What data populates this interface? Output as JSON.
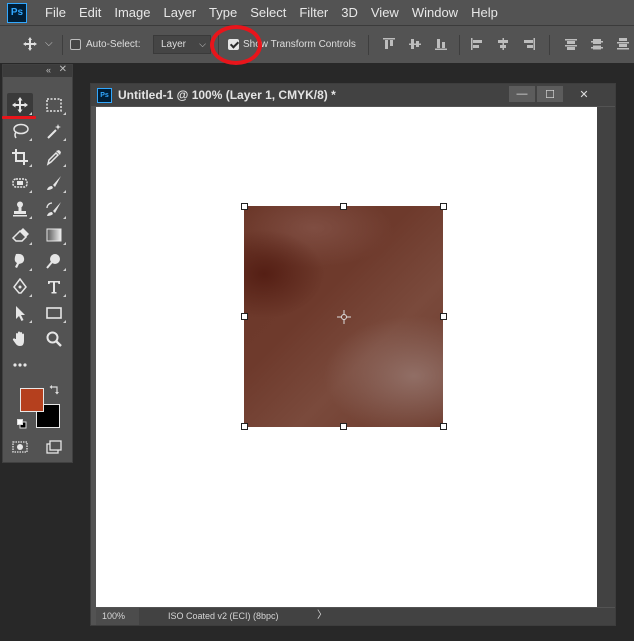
{
  "app": {
    "logo": "Ps",
    "menu": [
      "File",
      "Edit",
      "Image",
      "Layer",
      "Type",
      "Select",
      "Filter",
      "3D",
      "View",
      "Window",
      "Help"
    ]
  },
  "options": {
    "auto_select_label": "Auto-Select:",
    "auto_select_checked": false,
    "target_select_value": "Layer",
    "show_transform_label": "Show Transform Controls",
    "show_transform_checked": true,
    "annotation_color": "#e8151b"
  },
  "tools_panel": {
    "collapse_glyph": "«",
    "close_glyph": "✕",
    "foreground_color": "#b5401e",
    "background_color": "#000000",
    "tools": [
      {
        "name": "move-tool",
        "icon": "move-icon"
      },
      {
        "name": "marquee-tool",
        "icon": "rectangular-marquee-icon"
      },
      {
        "name": "lasso-tool",
        "icon": "lasso-icon"
      },
      {
        "name": "magic-wand-tool",
        "icon": "magic-wand-icon"
      },
      {
        "name": "crop-tool",
        "icon": "crop-icon"
      },
      {
        "name": "eyedropper-tool",
        "icon": "eyedropper-icon"
      },
      {
        "name": "healing-brush-tool",
        "icon": "healing-brush-icon"
      },
      {
        "name": "brush-tool",
        "icon": "brush-icon"
      },
      {
        "name": "clone-stamp-tool",
        "icon": "stamp-icon"
      },
      {
        "name": "history-brush-tool",
        "icon": "history-brush-icon"
      },
      {
        "name": "eraser-tool",
        "icon": "eraser-icon"
      },
      {
        "name": "gradient-tool",
        "icon": "gradient-icon"
      },
      {
        "name": "smudge-tool",
        "icon": "smudge-icon"
      },
      {
        "name": "dodge-tool",
        "icon": "dodge-icon"
      },
      {
        "name": "pen-tool",
        "icon": "pen-icon"
      },
      {
        "name": "type-tool",
        "icon": "type-icon"
      },
      {
        "name": "path-selection-tool",
        "icon": "arrow-icon"
      },
      {
        "name": "rectangle-tool",
        "icon": "rectangle-icon"
      },
      {
        "name": "hand-tool",
        "icon": "hand-icon"
      },
      {
        "name": "zoom-tool",
        "icon": "magnifier-icon"
      },
      {
        "name": "edit-toolbar",
        "icon": "more-icon"
      }
    ]
  },
  "document": {
    "logo": "Ps",
    "title": "Untitled-1 @ 100% (Layer 1, CMYK/8) *",
    "minimize_glyph": "—",
    "maximize_glyph": "☐",
    "close_glyph": "✕",
    "zoom": "100%",
    "color_profile": "ISO Coated v2 (ECI) (8bpc)",
    "status_chevron": "〉"
  }
}
